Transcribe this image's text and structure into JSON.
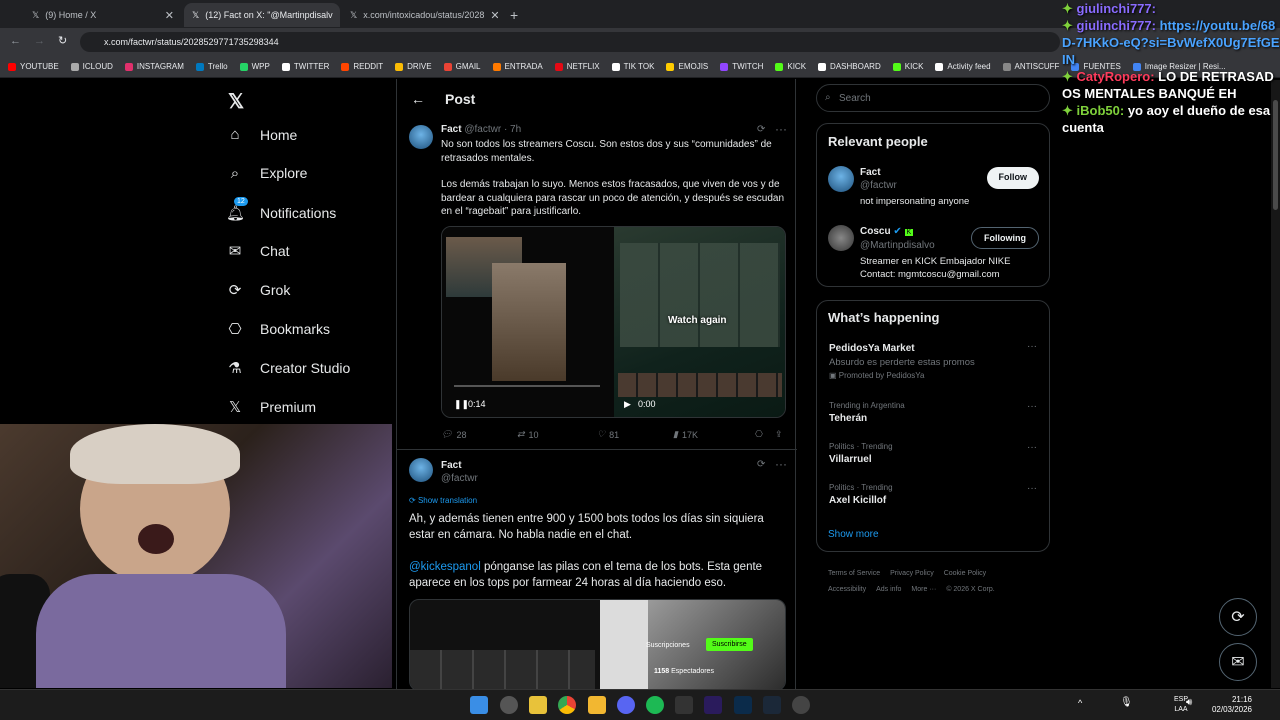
{
  "browser": {
    "tabs": [
      {
        "label": "(9) Home / X",
        "active": false
      },
      {
        "label": "(12) Fact on X: \"@Martinpdisalv",
        "active": true
      },
      {
        "label": "x.com/intoxicadou/status/2028",
        "active": false
      }
    ],
    "url": "x.com/factwr/status/2028529771735298344",
    "bookmarks": [
      "YOUTUBE",
      "ICLOUD",
      "INSTAGRAM",
      "Trello",
      "WPP",
      "TWITTER",
      "REDDIT",
      "DRIVE",
      "GMAIL",
      "ENTRADA",
      "NETFLIX",
      "TIK TOK",
      "EMOJIS",
      "TWITCH",
      "KICK",
      "DASHBOARD",
      "KICK",
      "Activity feed",
      "ANTISCUFF",
      "FUENTES",
      "Image Resizer | Resi..."
    ]
  },
  "sidebar": {
    "items": [
      {
        "label": "Home",
        "icon": "home-icon"
      },
      {
        "label": "Explore",
        "icon": "search-icon"
      },
      {
        "label": "Notifications",
        "icon": "bell-icon",
        "badge": "12"
      },
      {
        "label": "Chat",
        "icon": "mail-icon"
      },
      {
        "label": "Grok",
        "icon": "grok-icon"
      },
      {
        "label": "Bookmarks",
        "icon": "bookmark-icon"
      },
      {
        "label": "Creator Studio",
        "icon": "flask-icon"
      },
      {
        "label": "Premium",
        "icon": "x-logo-icon"
      }
    ]
  },
  "main": {
    "header": "Post",
    "tweet1": {
      "name": "Fact",
      "handle": "@factwr · 7h",
      "p1": "No son todos los streamers Coscu. Son estos dos y sus “comunidades” de retrasados mentales.",
      "p2": "Los demás trabajan lo suyo. Menos estos fracasados, que viven de vos y de bardear a cualquiera para rascar un poco de atención, y después se escudan en el “ragebait” para justificarlo.",
      "video_left_time": "0:14",
      "video_right_time": "0:00",
      "watch_again": "Watch again",
      "replies": "28",
      "reposts": "10",
      "likes": "81",
      "views": "17K"
    },
    "tweet2": {
      "name": "Fact",
      "handle": "@factwr",
      "show_translation": "Show translation",
      "p1": "Ah, y además tienen entre 900 y 1500 bots todos los días sin siquiera estar en cámara. No habla nadie en el chat.",
      "mention": "@kickespanol",
      "p2": " pónganse las pilas con el tema de los bots. Esta gente aparece en los tops por farmear 24 horas al día haciendo eso.",
      "subs_label": "Suscripciones",
      "subscribe_label": "Suscribirse",
      "viewers": "1158",
      "viewers_label": "Espectadores"
    }
  },
  "right": {
    "search_placeholder": "Search",
    "relevant_title": "Relevant people",
    "people": [
      {
        "name": "Fact",
        "handle": "@factwr",
        "bio": "not impersonating anyone",
        "button": "Follow"
      },
      {
        "name": "Coscu",
        "handle": "@Martinpdisalvo",
        "bio": "Streamer en KICK Embajador NIKE Contact: mgmtcoscu@gmail.com",
        "button": "Following"
      }
    ],
    "happening_title": "What’s happening",
    "trends": [
      {
        "context": "",
        "title": "PedidosYa Market",
        "sub": "Absurdo es perderte estas promos",
        "promo": "Promoted by PedidosYa"
      },
      {
        "context": "Trending in Argentina",
        "title": "Teherán"
      },
      {
        "context": "Politics · Trending",
        "title": "Villarruel"
      },
      {
        "context": "Politics · Trending",
        "title": "Axel Kicillof"
      }
    ],
    "show_more": "Show more",
    "footer": [
      "Terms of Service",
      "Privacy Policy",
      "Cookie Policy",
      "Accessibility",
      "Ads info",
      "More ···",
      "© 2026 X Corp."
    ]
  },
  "chat": [
    {
      "user": "giulinchi777:",
      "msg": "",
      "color": "#8a6cff"
    },
    {
      "user": "giulinchi777:",
      "msg": "https://youtu.be/68D-7HKkO-eQ?si=BvWefX0Ug7EfGEIN",
      "color": "#8a6cff"
    },
    {
      "user": "CatyRopero:",
      "msg": "LO DE RETRASADOS MENTALES BANQUÉ EH",
      "color": "#ff3b5c"
    },
    {
      "user": "iBob50:",
      "msg": "yo aoy el dueño de esa cuenta",
      "color": "#7fd13b"
    }
  ],
  "taskbar": {
    "lang": "ESP\nLAA",
    "time": "21:16",
    "date": "02/03/2026"
  }
}
